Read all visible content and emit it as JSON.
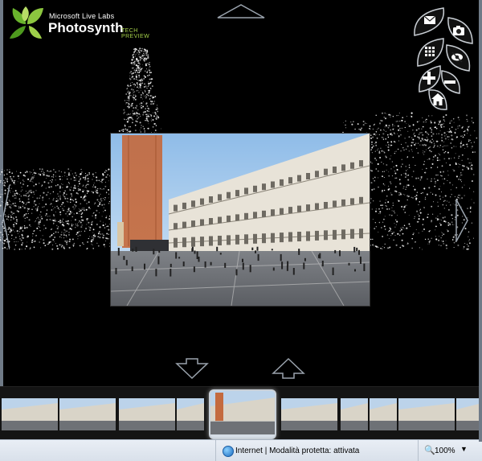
{
  "logo": {
    "line1": "Microsoft Live Labs",
    "line2": "Photosynth",
    "line3": "TECH PREVIEW"
  },
  "controls": [
    {
      "icon": "envelope-icon"
    },
    {
      "icon": "camera-icon"
    },
    {
      "icon": "grid-icon"
    },
    {
      "icon": "eye-icon"
    },
    {
      "icon": "zoom-in-icon"
    },
    {
      "icon": "zoom-out-icon"
    },
    {
      "icon": "home-icon"
    }
  ],
  "status": {
    "zone": "Internet | Modalità protetta: attivata",
    "zoom": "100%"
  },
  "colors": {
    "logo_accent": "#a6d24a",
    "sky": "#b9d7f2",
    "tower": "#c46a3e"
  }
}
